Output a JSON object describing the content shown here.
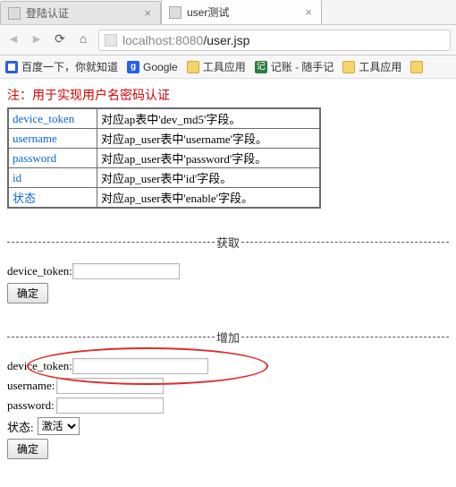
{
  "tabs": [
    {
      "title": "登陆认证",
      "active": false
    },
    {
      "title": "user测试",
      "active": true
    }
  ],
  "url": {
    "host": "localhost:",
    "port": "8080",
    "path": "/user.jsp"
  },
  "bookmarks": [
    {
      "label": "百度一下，你就知道"
    },
    {
      "label": "Google"
    },
    {
      "label": "工具应用"
    },
    {
      "label": "记账 - 随手记"
    },
    {
      "label": "工具应用"
    }
  ],
  "note": "注：用于实现用户名密码认证",
  "ref_rows": [
    {
      "key": "device_token",
      "val": "对应ap表中'dev_md5'字段。"
    },
    {
      "key": "username",
      "val": "对应ap_user表中'username'字段。"
    },
    {
      "key": "password",
      "val": "对应ap_user表中'password'字段。"
    },
    {
      "key": "id",
      "val": "对应ap_user表中'id'字段。"
    },
    {
      "key": "状态",
      "val": "对应ap_user表中'enable'字段。"
    }
  ],
  "sections": {
    "fetch": {
      "title": "获取",
      "device_token_label": "device_token:",
      "submit": "确定"
    },
    "add": {
      "title": "增加",
      "device_token_label": "device_token:",
      "username_label": "username:",
      "password_label": "password:",
      "status_label": "状态:",
      "status_selected": "激活",
      "submit": "确定"
    }
  }
}
